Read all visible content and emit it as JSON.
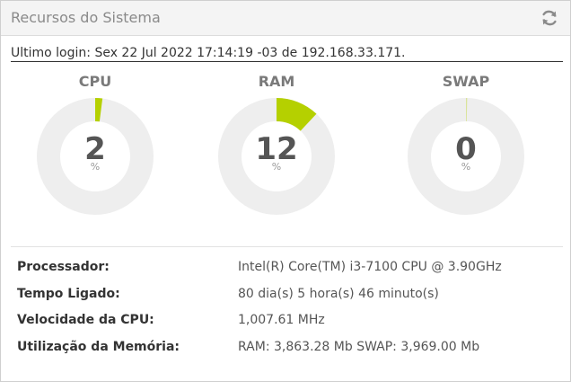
{
  "panel": {
    "title": "Recursos do Sistema",
    "refresh_icon": "refresh-icon"
  },
  "last_login": "Ultimo login: Sex 22 Jul 2022 17:14:19 -03 de 192.168.33.171.",
  "gauges": [
    {
      "label": "CPU",
      "value": "2",
      "unit": "%",
      "percent": 2
    },
    {
      "label": "RAM",
      "value": "12",
      "unit": "%",
      "percent": 12
    },
    {
      "label": "SWAP",
      "value": "0",
      "unit": "%",
      "percent": 0
    }
  ],
  "colors": {
    "gauge_fill": "#b5d000",
    "gauge_track": "#eeeeee",
    "header_bg": "#f4f4f4"
  },
  "info": [
    {
      "label": "Processador:",
      "value": "Intel(R) Core(TM) i3-7100 CPU @ 3.90GHz"
    },
    {
      "label": "Tempo Ligado:",
      "value": "80 dia(s) 5 hora(s) 46 minuto(s)"
    },
    {
      "label": "Velocidade da CPU:",
      "value": "1,007.61 MHz"
    },
    {
      "label": "Utilização da Memória:",
      "value": "RAM: 3,863.28 Mb SWAP: 3,969.00 Mb"
    }
  ]
}
